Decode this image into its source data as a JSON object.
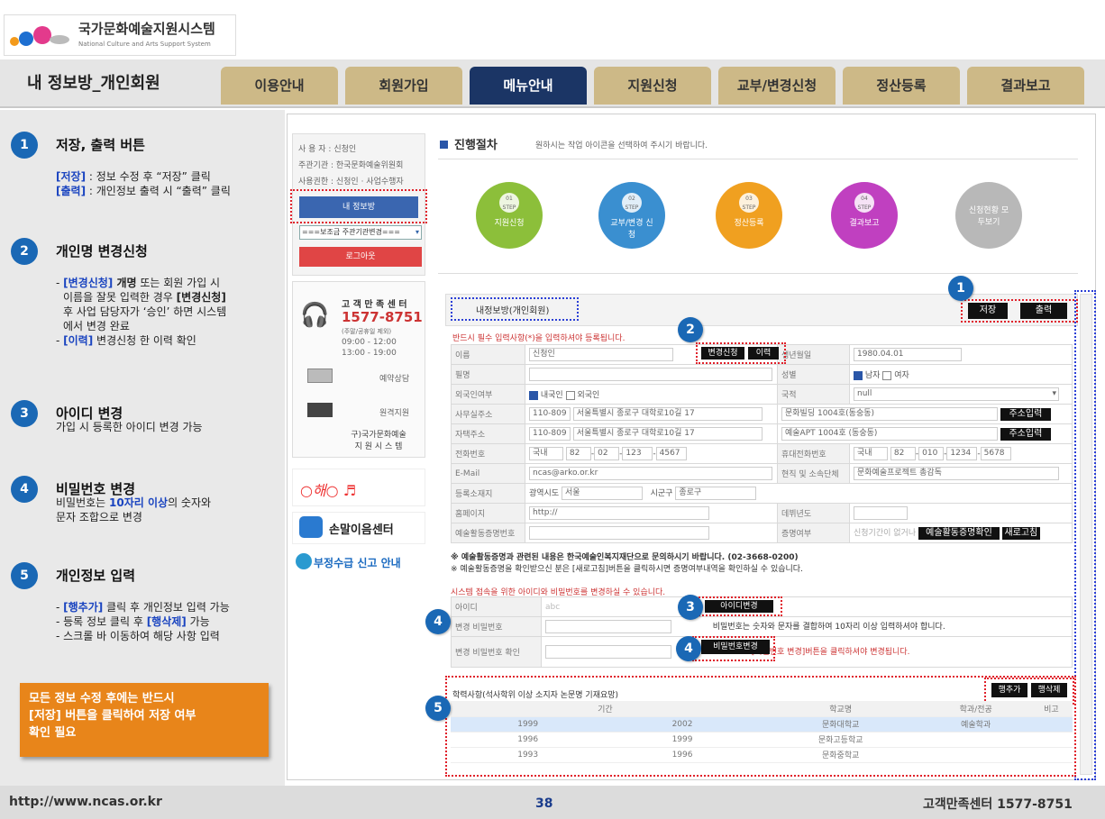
{
  "header": {
    "logo_kr": "국가문화예술지원시스템",
    "logo_en": "National Culture and Arts Support System",
    "page_title": "내 정보방_개인회원"
  },
  "tabs": [
    "이용안내",
    "회원가입",
    "메뉴안내",
    "지원신청",
    "교부/변경신청",
    "정산등록",
    "결과보고"
  ],
  "guide": {
    "s1": {
      "num": "1",
      "title": "저장, 출력 버튼",
      "l1a": "[저장]",
      "l1b": " : 정보 수정 후 “저장” 클릭",
      "l2a": "[출력]",
      "l2b": " : 개인정보 출력 시 “출력” 클릭"
    },
    "s2": {
      "num": "2",
      "title": "개인명 변경신청",
      "a": "- ",
      "b": "[변경신청]",
      "c": " 개명",
      "d": " 또는 회원 가입 시",
      "e": "이름을 잘못 입력한 경우 ",
      "f": "[변경신청]",
      "g": "후 사업 담당자가 ‘승인’ 하면 시스템",
      "h": "에서 변경 완료",
      "i": "- ",
      "j": "[이력]",
      "k": " 변경신청 한 이력 확인"
    },
    "s3": {
      "num": "3",
      "title": "아이디 변경",
      "desc": "가입 시 등록한 아이디  변경 가능"
    },
    "s4": {
      "num": "4",
      "title": "비밀번호 변경",
      "a": "비밀번호는 ",
      "b": "10자리 이상",
      "c": "의  숫자와",
      "d": "문자 조합으로 변경"
    },
    "s5": {
      "num": "5",
      "title": "개인정보 입력",
      "a": "- ",
      "b": "[행추가]",
      "c": " 클릭 후 개인정보 입력 가능",
      "d": "- 등록 정보 클릭 후 ",
      "e": "[행삭제]",
      "f": " 가능",
      "g": "- 스크롤 바 이동하여 해당 사항 입력"
    },
    "notice": {
      "l1": "모든 정보 수정 후에는 반드시",
      "l2": "[저장] 버튼을 클릭하여 저장 여부",
      "l3": "확인 필요"
    }
  },
  "screen": {
    "user": [
      "사 용 자 : 신청인",
      "주관기관 : 한국문화예술위원회",
      "사용권한 : 신청인 · 사업수행자"
    ],
    "my_info_btn": "내 정보방",
    "select": "===보조금 주관기관변경===",
    "logout": "로그아웃",
    "cs": {
      "title": "고 객 만 족 센 터",
      "phone": "1577-8751",
      "hours_note": "(주말/공휴일 제외)",
      "h1": "09:00 - 12:00",
      "h2": "13:00 - 19:00",
      "remote": "예약상담",
      "remote2": "원격지원",
      "org1": "구)국가문화예술",
      "org2": "지 원 시 스 템"
    },
    "banner1": "손말이음센터",
    "banner2": "부정수급 신고 안내",
    "proc_title": "진행절차",
    "proc_desc": "원하시는 작업 아이콘을 선택하여 주시기 바랍니다.",
    "steps": [
      {
        "no": "01",
        "sub": "STEP",
        "label": "지원신청",
        "color": "#8cbf3a"
      },
      {
        "no": "02",
        "sub": "STEP",
        "label": "교부/변경 신청",
        "color": "#3a8fd0"
      },
      {
        "no": "03",
        "sub": "STEP",
        "label": "정산등록",
        "color": "#f0a020"
      },
      {
        "no": "04",
        "sub": "STEP",
        "label": "결과보고",
        "color": "#c040c0"
      },
      {
        "no": "",
        "sub": "",
        "label": "신청현황 모두보기",
        "color": "#b8b8b8"
      }
    ],
    "myinfo_title": "내정보방(개인회원)",
    "save": "저장",
    "print": "출력",
    "required": "반드시 필수 입력사항(*)을 입력하셔야 등록됩니다.",
    "change_req": "변경신청",
    "history": "이력",
    "form": {
      "name_l": "이름",
      "name_v": "신청인",
      "birth_l": "생년월일",
      "birth_v": "1980.04.01",
      "pen_l": "필명",
      "gender_l": "성별",
      "male": "남자",
      "female": "여자",
      "foreign_l": "외국인여부",
      "kor": "내국인",
      "for": "외국인",
      "country_l": "국적",
      "country_v": "null",
      "office_l": "사무실주소",
      "zip1": "110-809",
      "addr1": "서울특별시 종로구 대학로10길 17",
      "addr1b": "문화빌딩 1004호(동숭동)",
      "addr_btn": "주소입력",
      "home_l": "자택주소",
      "zip2": "110-809",
      "addr2": "서울특별시 종로구 대학로10길 17",
      "addr2b": "예술APT 1004호 (동숭동)",
      "tel_l": "전화번호",
      "tel_c": "국내",
      "tel1": "82",
      "tel2": "02",
      "tel3": "123",
      "tel4": "4567",
      "mob_l": "휴대전화번호",
      "mob_c": "국내",
      "mob1": "82",
      "mob2": "010",
      "mob3": "1234",
      "mob4": "5678",
      "email_l": "E-Mail",
      "email_v": "ncas@arko.or.kr",
      "job_l": "현직 및 소속단체",
      "job_v": "문화예술프로젝트 총감독",
      "area_l": "등록소재지",
      "sido_l": "광역시도",
      "sido_v": "서울",
      "sigungu_l": "시군구",
      "sigungu_v": "종로구",
      "home_page_l": "홈페이지",
      "home_page_v": "http://",
      "debut_l": "데뷔년도",
      "cert_l": "예술활동증명번호",
      "cert2_l": "증명여부",
      "cert_note": "신청기간이 없거나",
      "cert_btn": "예술활동증명확인",
      "refresh": "새로고침"
    },
    "notes": [
      "※ 예술활동증명과 관련된 내용은 한국예술인복지재단으로 문의하시기 바랍니다. (02-3668-0200)",
      "※ 예술활동증명을 확인받으신 분은 [새로고침]버튼을 클릭하시면 증명여부내역을 확인하실 수 있습니다."
    ],
    "id_section": "시스템 접속을 위한 아이디와 비밀번호를 변경하실 수 있습니다.",
    "id_l": "아이디",
    "id_v": "abc",
    "id_btn": "아이디변경",
    "pw_new_l": "변경 비밀번호",
    "pw_rule": "비밀번호는 숫자와 문자를 결합하여 10자리 이상 입력하셔야 합니다.",
    "pw_confirm_l": "변경 비밀번호 확인",
    "pw_btn": "비밀번호변경",
    "pw_hint": "[비밀번호 변경]버튼을 클릭하셔야 변경됩니다.",
    "edu_title": "학력사항(석사학위 이상 소지자 논문명 기재요망)",
    "add_row": "행추가",
    "del_row": "행삭제",
    "edu_head": [
      "기간",
      "학교명",
      "학과/전공",
      "비고"
    ],
    "edu_rows": [
      [
        "1999",
        "2002",
        "문화대학교",
        "예술학과",
        ""
      ],
      [
        "1996",
        "1999",
        "문화고등학교",
        "",
        ""
      ],
      [
        "1993",
        "1996",
        "문화중학교",
        "",
        ""
      ]
    ],
    "markers": {
      "m1": "1",
      "m2": "2",
      "m3": "3",
      "m4a": "4",
      "m4b": "4",
      "m5": "5"
    }
  },
  "footer": {
    "url": "http://www.ncas.or.kr",
    "page": "38",
    "cs": "고객만족센터 1577-8751"
  }
}
